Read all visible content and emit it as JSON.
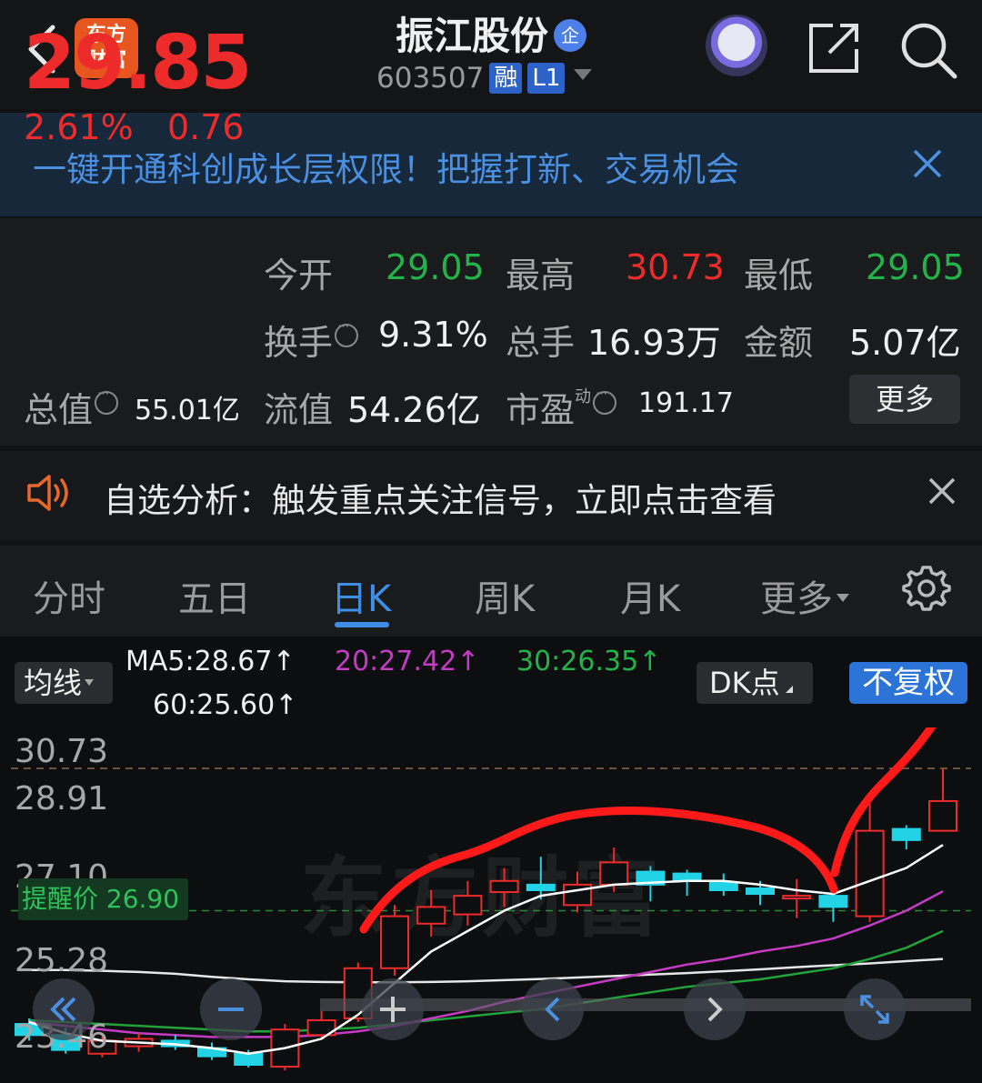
{
  "header": {
    "stock_name": "振江股份",
    "qi_badge": "企",
    "code": "603507",
    "tag_rong": "融",
    "tag_level": "L1",
    "logo_line1": "东方",
    "logo_line2": "财富"
  },
  "banner": {
    "text": "一键开通科创成长层权限！把握打新、交易机会"
  },
  "quote": {
    "price": "29.85",
    "change_pct": "2.61%",
    "change_val": "0.76",
    "open_label": "今开",
    "open_value": "29.05",
    "high_label": "最高",
    "high_value": "30.73",
    "low_label": "最低",
    "low_value": "29.05",
    "turnover_label": "换手",
    "turnover_value": "9.31%",
    "volume_label": "总手",
    "volume_value": "16.93万",
    "amount_label": "金额",
    "amount_value": "5.07亿",
    "mktcap_label": "总值",
    "mktcap_value": "55.01亿",
    "float_label": "流值",
    "float_value": "54.26亿",
    "pe_label": "市盈",
    "pe_sup": "动",
    "pe_value": "191.17",
    "more_label": "更多"
  },
  "alert": {
    "text": "自选分析：触发重点关注信号，立即点击查看"
  },
  "tabs": [
    {
      "label": "分时"
    },
    {
      "label": "五日"
    },
    {
      "label": "日K"
    },
    {
      "label": "周K"
    },
    {
      "label": "月K"
    },
    {
      "label": "更多"
    }
  ],
  "chart_controls": {
    "ma_button": "均线",
    "ma5": "MA5:28.67↑",
    "ma20": "20:27.42↑",
    "ma30": "30:26.35↑",
    "ma60": "60:25.60↑",
    "dk_button": "DK点",
    "fq_button": "不复权"
  },
  "chart_labels": {
    "y_top": "30.73",
    "y_2": "28.91",
    "y_3": "27.10",
    "y_4": "25.28",
    "y_bottom": "23.46",
    "remind": "提醒价 26.90",
    "watermark": "东方财富"
  },
  "colors": {
    "up": "#ee2b2b",
    "down": "#22d3e6",
    "accent": "#3f8ee6",
    "ma5": "#ffffff",
    "ma20": "#c43bc4",
    "ma30": "#22a33a",
    "ma60": "#e6e6e6"
  },
  "chart_data": {
    "type": "candlestick",
    "y_ticks": [
      30.73,
      28.91,
      27.1,
      25.28,
      23.46
    ],
    "remind_price": 26.9,
    "candles": [
      {
        "o": 23.85,
        "c": 23.55,
        "h": 24.0,
        "l": 23.4
      },
      {
        "o": 23.55,
        "c": 23.15,
        "h": 23.75,
        "l": 23.05
      },
      {
        "o": 23.05,
        "c": 23.4,
        "h": 23.5,
        "l": 22.95
      },
      {
        "o": 23.25,
        "c": 23.45,
        "h": 23.6,
        "l": 23.1
      },
      {
        "o": 23.4,
        "c": 23.25,
        "h": 23.55,
        "l": 23.15
      },
      {
        "o": 23.2,
        "c": 22.98,
        "h": 23.35,
        "l": 22.88
      },
      {
        "o": 23.05,
        "c": 22.75,
        "h": 23.15,
        "l": 22.68
      },
      {
        "o": 22.7,
        "c": 23.7,
        "h": 23.85,
        "l": 22.6
      },
      {
        "o": 23.55,
        "c": 23.95,
        "h": 24.2,
        "l": 23.45
      },
      {
        "o": 24.0,
        "c": 25.35,
        "h": 25.5,
        "l": 23.9
      },
      {
        "o": 25.35,
        "c": 26.75,
        "h": 27.05,
        "l": 25.15
      },
      {
        "o": 26.55,
        "c": 27.0,
        "h": 27.45,
        "l": 26.2
      },
      {
        "o": 26.8,
        "c": 27.3,
        "h": 27.7,
        "l": 26.5
      },
      {
        "o": 27.4,
        "c": 27.7,
        "h": 28.05,
        "l": 27.0
      },
      {
        "o": 27.6,
        "c": 27.45,
        "h": 28.35,
        "l": 27.2
      },
      {
        "o": 27.05,
        "c": 27.6,
        "h": 27.95,
        "l": 26.85
      },
      {
        "o": 27.6,
        "c": 28.2,
        "h": 28.6,
        "l": 27.4
      },
      {
        "o": 27.95,
        "c": 27.6,
        "h": 28.1,
        "l": 27.15
      },
      {
        "o": 27.9,
        "c": 27.7,
        "h": 28.0,
        "l": 27.3
      },
      {
        "o": 27.65,
        "c": 27.45,
        "h": 27.9,
        "l": 27.3
      },
      {
        "o": 27.5,
        "c": 27.35,
        "h": 27.7,
        "l": 27.05
      },
      {
        "o": 27.25,
        "c": 27.3,
        "h": 27.75,
        "l": 26.7
      },
      {
        "o": 27.3,
        "c": 27.0,
        "h": 27.5,
        "l": 26.6
      },
      {
        "o": 26.75,
        "c": 29.05,
        "h": 29.9,
        "l": 26.6
      },
      {
        "o": 29.1,
        "c": 28.8,
        "h": 29.2,
        "l": 28.55
      },
      {
        "o": 29.05,
        "c": 29.85,
        "h": 30.73,
        "l": 29.05
      }
    ],
    "ma5": [
      23.9,
      23.6,
      23.4,
      23.35,
      23.3,
      23.2,
      23.05,
      23.2,
      23.45,
      24.1,
      24.95,
      25.8,
      26.35,
      26.9,
      27.3,
      27.45,
      27.6,
      27.65,
      27.7,
      27.7,
      27.6,
      27.45,
      27.35,
      27.7,
      28.05,
      28.67
    ],
    "ma20": [
      23.9,
      23.8,
      23.7,
      23.6,
      23.55,
      23.5,
      23.5,
      23.5,
      23.55,
      23.65,
      23.8,
      24.0,
      24.2,
      24.45,
      24.65,
      24.85,
      25.05,
      25.25,
      25.45,
      25.6,
      25.8,
      25.95,
      26.15,
      26.5,
      26.9,
      27.42
    ],
    "ma30": [
      23.95,
      23.9,
      23.85,
      23.8,
      23.75,
      23.7,
      23.65,
      23.65,
      23.7,
      23.75,
      23.85,
      23.95,
      24.05,
      24.15,
      24.25,
      24.4,
      24.55,
      24.7,
      24.85,
      24.95,
      25.05,
      25.2,
      25.35,
      25.6,
      25.9,
      26.35
    ],
    "ma60": [
      25.3,
      25.3,
      25.28,
      25.25,
      25.2,
      25.12,
      25.05,
      25.0,
      24.98,
      24.97,
      24.97,
      24.98,
      25.0,
      25.03,
      25.06,
      25.1,
      25.14,
      25.18,
      25.22,
      25.27,
      25.32,
      25.38,
      25.43,
      25.48,
      25.54,
      25.6
    ]
  }
}
